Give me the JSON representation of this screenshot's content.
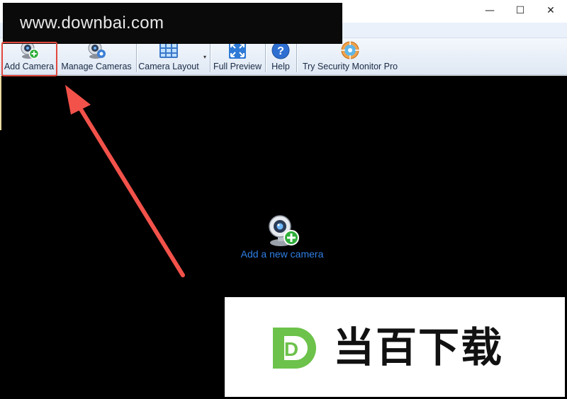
{
  "window": {
    "minimize_glyph": "—",
    "maximize_glyph": "☐",
    "close_glyph": "✕"
  },
  "watermark_top": {
    "text": "www.downbai.com"
  },
  "toolbar": {
    "add_camera": "Add Camera",
    "manage_cameras": "Manage Cameras",
    "camera_layout": "Camera Layout",
    "full_preview": "Full Preview",
    "help": "Help",
    "try_pro": "Try Security Monitor Pro",
    "dropdown_glyph": "▾"
  },
  "viewport": {
    "add_new_camera": "Add a new camera"
  },
  "watermark_bottom": {
    "brand_text": "当百下载",
    "logo_letter": "D"
  },
  "colors": {
    "accent_link": "#2f7fe6",
    "highlight_red": "#e2483d",
    "logo_green": "#6cc24a",
    "toolbar_bg": "#e6eef8"
  }
}
